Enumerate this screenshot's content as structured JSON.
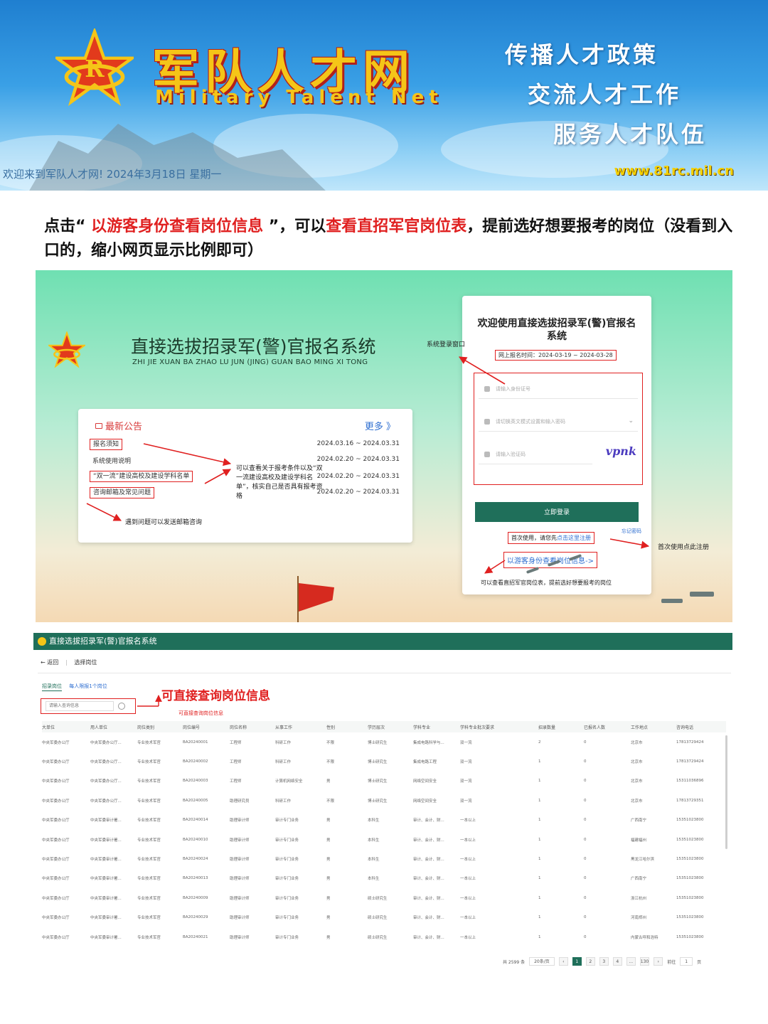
{
  "banner": {
    "brand_cn": "军队人才网",
    "brand_en": "Military Talent Net",
    "slogans": [
      "传播人才政策",
      "交流人才工作",
      "服务人才队伍"
    ],
    "welcome": "欢迎来到军队人才网!  2024年3月18日 星期一",
    "url": "www.81rc.mil.cn"
  },
  "instruction": {
    "part1": "点击“ ",
    "highlight1": "以游客身份查看岗位信息",
    "part2": " ”，可以",
    "highlight2": "查看直招军官岗位表",
    "part3": "，提前选好想要报考的岗位（没看到入口的，缩小网页显示比例即可）"
  },
  "login": {
    "system_title": "直接选拔招录军(警)官报名系统",
    "system_pinyin": "ZHI JIE XUAN BA ZHAO LU JUN (JING) GUAN BAO MING XI TONG",
    "notice_head": "最新公告",
    "notice_more": "更多 》",
    "notices": [
      {
        "title": "报名须知",
        "date": "2024.03.16 ~ 2024.03.31"
      },
      {
        "title": "系统使用说明",
        "date": "2024.02.20 ~ 2024.03.31"
      },
      {
        "title": "“双一流”建设高校及建设学科名单",
        "date": "2024.02.20 ~ 2024.03.31"
      },
      {
        "title": "咨询邮箱及常见问题",
        "date": "2024.02.20 ~ 2024.03.31"
      }
    ],
    "note_check": "可以查看关于报考条件以及“双一流建设高校及建设学科名单”，核实自己是否具有报考资格",
    "note_email": "遇到问题可以发送邮箱咨询",
    "note_entry": "系统登录窗口",
    "card_title": "欢迎使用直接选拔招录军(警)官报名系统",
    "card_time": "网上报名时间：2024-03-19 ~ 2024-03-28",
    "placeholder_id": "请输入身份证号",
    "placeholder_pwd": "请切换英文模式设置和输入密码",
    "placeholder_code": "请输入验证码",
    "captcha": "vpnk",
    "login_btn": "立即登录",
    "forgot": "忘记密码",
    "first_use": "首次使用，请您先",
    "register_link": "点击这里注册",
    "guest_link": "以游客身份查看岗位信息->",
    "note_register": "首次使用点此注册",
    "note_guest": "可以查看直招军官岗位表，提前选好想要报考的岗位"
  },
  "table": {
    "header_title": "直接选拔招录军(警)官报名系统",
    "back": "返回",
    "crumb": "选择岗位",
    "tab_active": "招录岗位",
    "tab_other": "每人限报1个岗位",
    "big_note": "可直接查询岗位信息",
    "search_placeholder": "请输入查询信息",
    "search_note": "可直接查询岗位信息",
    "columns": [
      "大单位",
      "用人单位",
      "岗位类别",
      "岗位编号",
      "岗位名称",
      "从事工作",
      "性别",
      "学历层次",
      "学科专业",
      "学科专业批次要求",
      "招录数量",
      "已报名人数",
      "工作地点",
      "咨询电话"
    ],
    "rows": [
      [
        "中央军委办公厅",
        "中央军委办公厅...",
        "专业技术军官",
        "BA20240001",
        "工程师",
        "科研工作",
        "不限",
        "博士研究生",
        "集成电路科学与...",
        "双一流",
        "2",
        "0",
        "北京市",
        "17813729424"
      ],
      [
        "中央军委办公厅",
        "中央军委办公厅...",
        "专业技术军官",
        "BA20240002",
        "工程师",
        "科研工作",
        "不限",
        "博士研究生",
        "集成电路工程",
        "双一流",
        "1",
        "0",
        "北京市",
        "17813729424"
      ],
      [
        "中央军委办公厅",
        "中央军委办公厅...",
        "专业技术军官",
        "BA20240003",
        "工程师",
        "计算机网络安全",
        "男",
        "博士研究生",
        "网络空间安全",
        "双一流",
        "1",
        "0",
        "北京市",
        "15311036896"
      ],
      [
        "中央军委办公厅",
        "中央军委办公厅...",
        "专业技术军官",
        "BA20240005",
        "助理研究员",
        "科研工作",
        "不限",
        "博士研究生",
        "网络空间安全",
        "双一流",
        "1",
        "0",
        "北京市",
        "17813729351"
      ],
      [
        "中央军委办公厅",
        "中央军委审计署...",
        "专业技术军官",
        "BA20240014",
        "助理审计师",
        "审计专门业务",
        "男",
        "本科生",
        "审计、会计、财...",
        "一本以上",
        "1",
        "0",
        "广西南宁",
        "15351023800"
      ],
      [
        "中央军委办公厅",
        "中央军委审计署...",
        "专业技术军官",
        "BA20240010",
        "助理审计师",
        "审计专门业务",
        "男",
        "本科生",
        "审计、会计、财...",
        "一本以上",
        "1",
        "0",
        "福建福州",
        "15351023800"
      ],
      [
        "中央军委办公厅",
        "中央军委审计署...",
        "专业技术军官",
        "BA20240024",
        "助理审计师",
        "审计专门业务",
        "男",
        "本科生",
        "审计、会计、财...",
        "一本以上",
        "1",
        "0",
        "黑龙江哈尔滨",
        "15351023800"
      ],
      [
        "中央军委办公厅",
        "中央军委审计署...",
        "专业技术军官",
        "BA20240013",
        "助理审计师",
        "审计专门业务",
        "男",
        "本科生",
        "审计、会计、财...",
        "一本以上",
        "1",
        "0",
        "广西南宁",
        "15351023800"
      ],
      [
        "中央军委办公厅",
        "中央军委审计署...",
        "专业技术军官",
        "BA20240009",
        "助理审计师",
        "审计专门业务",
        "男",
        "硕士研究生",
        "审计、会计、财...",
        "一本以上",
        "1",
        "0",
        "浙江杭州",
        "15351023800"
      ],
      [
        "中央军委办公厅",
        "中央军委审计署...",
        "专业技术军官",
        "BA20240029",
        "助理审计师",
        "审计专门业务",
        "男",
        "硕士研究生",
        "审计、会计、财...",
        "一本以上",
        "1",
        "0",
        "河南郑州",
        "15351023800"
      ],
      [
        "中央军委办公厅",
        "中央军委审计署...",
        "专业技术军官",
        "BA20240021",
        "助理审计师",
        "审计专门业务",
        "男",
        "硕士研究生",
        "审计、会计、财...",
        "一本以上",
        "1",
        "0",
        "内蒙古呼和浩特",
        "15351023800"
      ]
    ],
    "pager": {
      "total": "共 2599 条",
      "page_size": "20条/页",
      "pages": [
        "1",
        "2",
        "3",
        "4",
        "...",
        "130"
      ],
      "goto_label": "前往",
      "goto_value": "1",
      "goto_unit": "页"
    }
  },
  "colors": {
    "accent_green": "#1f6f5a",
    "highlight_red": "#e02020",
    "link_blue": "#2f6fd1",
    "brand_gold": "#f5c518"
  }
}
